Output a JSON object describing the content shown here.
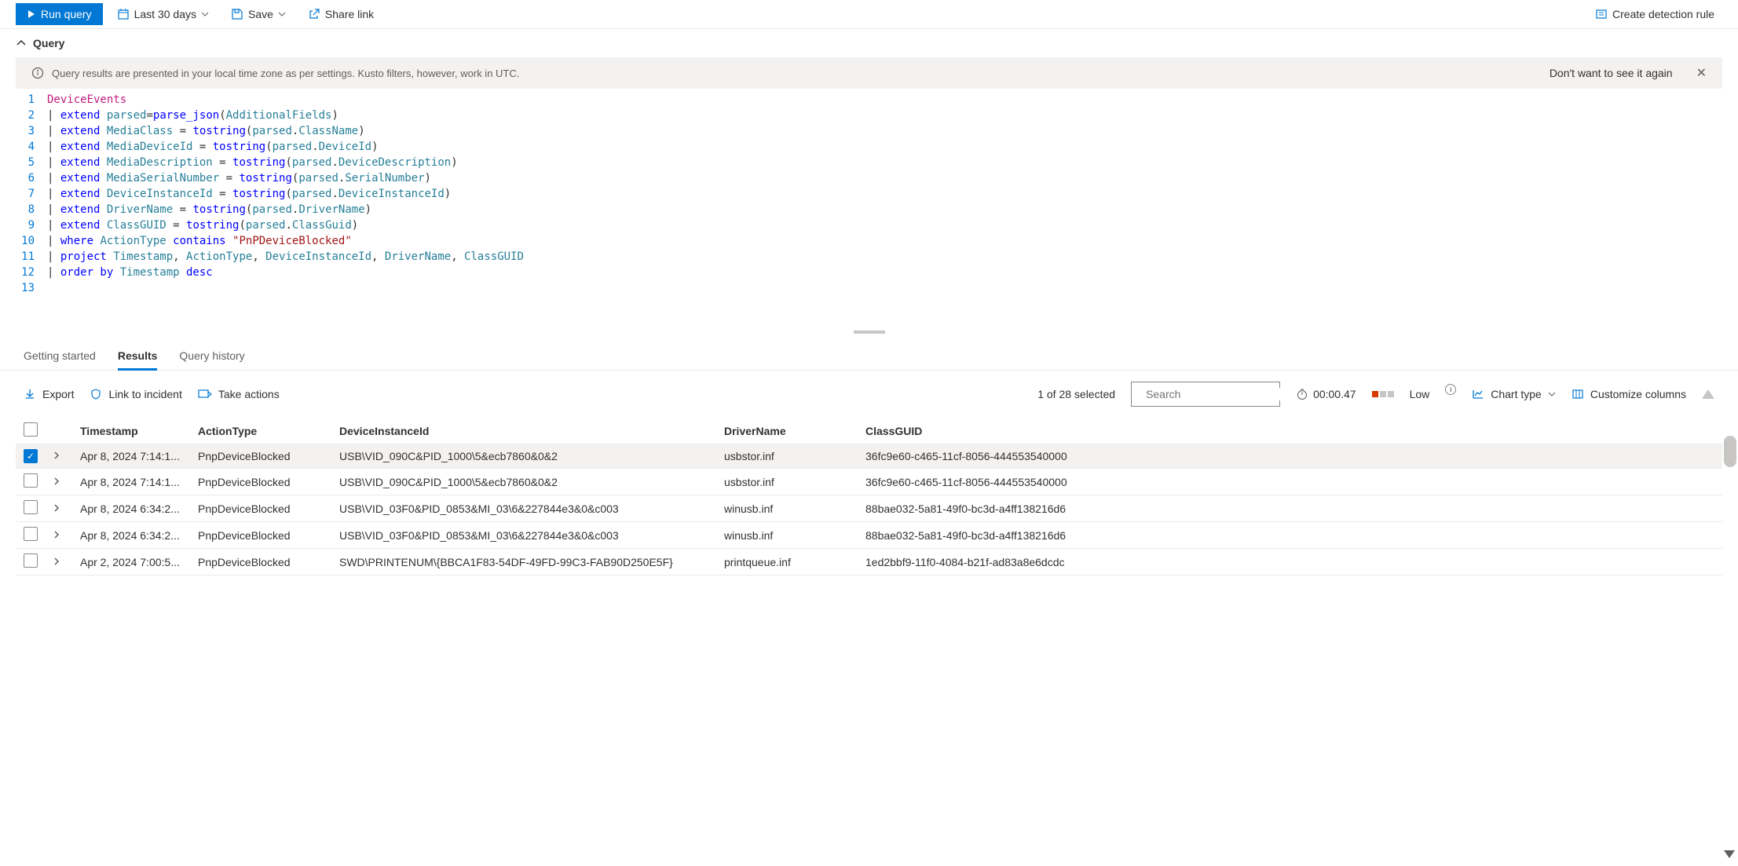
{
  "toolbar": {
    "run_label": "Run query",
    "timerange_label": "Last 30 days",
    "save_label": "Save",
    "share_label": "Share link",
    "create_rule_label": "Create detection rule"
  },
  "section": {
    "title": "Query"
  },
  "banner": {
    "message": "Query results are presented in your local time zone as per settings. Kusto filters, however, work in UTC.",
    "dismiss": "Don't want to see it again"
  },
  "editor": {
    "line_numbers": [
      "1",
      "2",
      "3",
      "4",
      "5",
      "6",
      "7",
      "8",
      "9",
      "10",
      "11",
      "12",
      "13"
    ],
    "lines": [
      [
        {
          "t": "DeviceEvents",
          "c": "tk-tbl"
        }
      ],
      [
        {
          "t": "| ",
          "c": "tk-p"
        },
        {
          "t": "extend ",
          "c": "tk-kw"
        },
        {
          "t": "parsed",
          "c": "tk-col"
        },
        {
          "t": "=",
          "c": "tk-op"
        },
        {
          "t": "parse_json",
          "c": "tk-fn"
        },
        {
          "t": "(",
          "c": "tk-p"
        },
        {
          "t": "AdditionalFields",
          "c": "tk-col"
        },
        {
          "t": ")",
          "c": "tk-p"
        }
      ],
      [
        {
          "t": "| ",
          "c": "tk-p"
        },
        {
          "t": "extend ",
          "c": "tk-kw"
        },
        {
          "t": "MediaClass",
          "c": "tk-col"
        },
        {
          "t": " = ",
          "c": "tk-op"
        },
        {
          "t": "tostring",
          "c": "tk-fn"
        },
        {
          "t": "(",
          "c": "tk-p"
        },
        {
          "t": "parsed",
          "c": "tk-col"
        },
        {
          "t": ".",
          "c": "tk-p"
        },
        {
          "t": "ClassName",
          "c": "tk-fld"
        },
        {
          "t": ")",
          "c": "tk-p"
        }
      ],
      [
        {
          "t": "| ",
          "c": "tk-p"
        },
        {
          "t": "extend ",
          "c": "tk-kw"
        },
        {
          "t": "MediaDeviceId",
          "c": "tk-col"
        },
        {
          "t": " = ",
          "c": "tk-op"
        },
        {
          "t": "tostring",
          "c": "tk-fn"
        },
        {
          "t": "(",
          "c": "tk-p"
        },
        {
          "t": "parsed",
          "c": "tk-col"
        },
        {
          "t": ".",
          "c": "tk-p"
        },
        {
          "t": "DeviceId",
          "c": "tk-fld"
        },
        {
          "t": ")",
          "c": "tk-p"
        }
      ],
      [
        {
          "t": "| ",
          "c": "tk-p"
        },
        {
          "t": "extend ",
          "c": "tk-kw"
        },
        {
          "t": "MediaDescription",
          "c": "tk-col"
        },
        {
          "t": " = ",
          "c": "tk-op"
        },
        {
          "t": "tostring",
          "c": "tk-fn"
        },
        {
          "t": "(",
          "c": "tk-p"
        },
        {
          "t": "parsed",
          "c": "tk-col"
        },
        {
          "t": ".",
          "c": "tk-p"
        },
        {
          "t": "DeviceDescription",
          "c": "tk-fld"
        },
        {
          "t": ")",
          "c": "tk-p"
        }
      ],
      [
        {
          "t": "| ",
          "c": "tk-p"
        },
        {
          "t": "extend ",
          "c": "tk-kw"
        },
        {
          "t": "MediaSerialNumber",
          "c": "tk-col"
        },
        {
          "t": " = ",
          "c": "tk-op"
        },
        {
          "t": "tostring",
          "c": "tk-fn"
        },
        {
          "t": "(",
          "c": "tk-p"
        },
        {
          "t": "parsed",
          "c": "tk-col"
        },
        {
          "t": ".",
          "c": "tk-p"
        },
        {
          "t": "SerialNumber",
          "c": "tk-fld"
        },
        {
          "t": ")",
          "c": "tk-p"
        }
      ],
      [
        {
          "t": "| ",
          "c": "tk-p"
        },
        {
          "t": "extend ",
          "c": "tk-kw"
        },
        {
          "t": "DeviceInstanceId",
          "c": "tk-col"
        },
        {
          "t": " = ",
          "c": "tk-op"
        },
        {
          "t": "tostring",
          "c": "tk-fn"
        },
        {
          "t": "(",
          "c": "tk-p"
        },
        {
          "t": "parsed",
          "c": "tk-col"
        },
        {
          "t": ".",
          "c": "tk-p"
        },
        {
          "t": "DeviceInstanceId",
          "c": "tk-fld"
        },
        {
          "t": ")",
          "c": "tk-p"
        }
      ],
      [
        {
          "t": "| ",
          "c": "tk-p"
        },
        {
          "t": "extend ",
          "c": "tk-kw"
        },
        {
          "t": "DriverName",
          "c": "tk-col"
        },
        {
          "t": " = ",
          "c": "tk-op"
        },
        {
          "t": "tostring",
          "c": "tk-fn"
        },
        {
          "t": "(",
          "c": "tk-p"
        },
        {
          "t": "parsed",
          "c": "tk-col"
        },
        {
          "t": ".",
          "c": "tk-p"
        },
        {
          "t": "DriverName",
          "c": "tk-fld"
        },
        {
          "t": ")",
          "c": "tk-p"
        }
      ],
      [
        {
          "t": "| ",
          "c": "tk-p"
        },
        {
          "t": "extend ",
          "c": "tk-kw"
        },
        {
          "t": "ClassGUID",
          "c": "tk-col"
        },
        {
          "t": " = ",
          "c": "tk-op"
        },
        {
          "t": "tostring",
          "c": "tk-fn"
        },
        {
          "t": "(",
          "c": "tk-p"
        },
        {
          "t": "parsed",
          "c": "tk-col"
        },
        {
          "t": ".",
          "c": "tk-p"
        },
        {
          "t": "ClassGuid",
          "c": "tk-fld"
        },
        {
          "t": ")",
          "c": "tk-p"
        }
      ],
      [
        {
          "t": "| ",
          "c": "tk-p"
        },
        {
          "t": "where ",
          "c": "tk-kw"
        },
        {
          "t": "ActionType",
          "c": "tk-col"
        },
        {
          "t": " contains ",
          "c": "tk-kw"
        },
        {
          "t": "\"PnPDeviceBlocked\"",
          "c": "tk-str"
        }
      ],
      [
        {
          "t": "| ",
          "c": "tk-p"
        },
        {
          "t": "project ",
          "c": "tk-kw"
        },
        {
          "t": "Timestamp",
          "c": "tk-col"
        },
        {
          "t": ", ",
          "c": "tk-p"
        },
        {
          "t": "ActionType",
          "c": "tk-col"
        },
        {
          "t": ", ",
          "c": "tk-p"
        },
        {
          "t": "DeviceInstanceId",
          "c": "tk-col"
        },
        {
          "t": ", ",
          "c": "tk-p"
        },
        {
          "t": "DriverName",
          "c": "tk-col"
        },
        {
          "t": ", ",
          "c": "tk-p"
        },
        {
          "t": "ClassGUID",
          "c": "tk-col"
        }
      ],
      [
        {
          "t": "| ",
          "c": "tk-p"
        },
        {
          "t": "order by ",
          "c": "tk-kw"
        },
        {
          "t": "Timestamp",
          "c": "tk-col"
        },
        {
          "t": " desc",
          "c": "tk-kw"
        }
      ],
      []
    ]
  },
  "tabs": {
    "getting_started": "Getting started",
    "results": "Results",
    "history": "Query history"
  },
  "results_bar": {
    "export": "Export",
    "link_incident": "Link to incident",
    "take_actions": "Take actions",
    "selection_text": "1 of 28 selected",
    "search_placeholder": "Search",
    "timer": "00:00.47",
    "severity": "Low",
    "chart_type": "Chart type",
    "customize": "Customize columns"
  },
  "grid": {
    "headers": {
      "timestamp": "Timestamp",
      "actiontype": "ActionType",
      "deviceinstanceid": "DeviceInstanceId",
      "drivername": "DriverName",
      "classguid": "ClassGUID"
    },
    "rows": [
      {
        "selected": true,
        "ts": "Apr 8, 2024 7:14:1...",
        "at": "PnpDeviceBlocked",
        "di": "USB\\VID_090C&PID_1000\\5&ecb7860&0&2",
        "dn": "usbstor.inf",
        "cg": "36fc9e60-c465-11cf-8056-444553540000"
      },
      {
        "selected": false,
        "ts": "Apr 8, 2024 7:14:1...",
        "at": "PnpDeviceBlocked",
        "di": "USB\\VID_090C&PID_1000\\5&ecb7860&0&2",
        "dn": "usbstor.inf",
        "cg": "36fc9e60-c465-11cf-8056-444553540000"
      },
      {
        "selected": false,
        "ts": "Apr 8, 2024 6:34:2...",
        "at": "PnpDeviceBlocked",
        "di": "USB\\VID_03F0&PID_0853&MI_03\\6&227844e3&0&c003",
        "dn": "winusb.inf",
        "cg": "88bae032-5a81-49f0-bc3d-a4ff138216d6"
      },
      {
        "selected": false,
        "ts": "Apr 8, 2024 6:34:2...",
        "at": "PnpDeviceBlocked",
        "di": "USB\\VID_03F0&PID_0853&MI_03\\6&227844e3&0&c003",
        "dn": "winusb.inf",
        "cg": "88bae032-5a81-49f0-bc3d-a4ff138216d6"
      },
      {
        "selected": false,
        "ts": "Apr 2, 2024 7:00:5...",
        "at": "PnpDeviceBlocked",
        "di": "SWD\\PRINTENUM\\{BBCA1F83-54DF-49FD-99C3-FAB90D250E5F}",
        "dn": "printqueue.inf",
        "cg": "1ed2bbf9-11f0-4084-b21f-ad83a8e6dcdc"
      }
    ]
  }
}
